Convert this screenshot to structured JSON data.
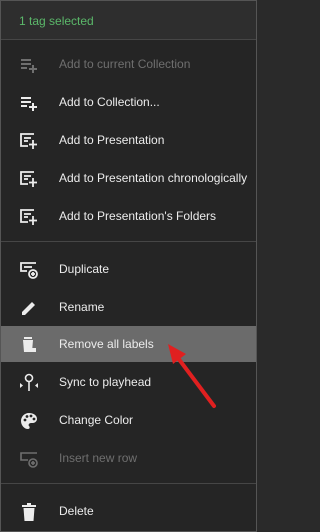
{
  "header": {
    "title": "1 tag selected"
  },
  "items": [
    {
      "label": "Add to current Collection",
      "icon": "playlist-add-icon",
      "disabled": true
    },
    {
      "label": "Add to Collection...",
      "icon": "playlist-add-icon"
    },
    {
      "label": "Add to Presentation",
      "icon": "presentation-add-icon"
    },
    {
      "label": "Add to Presentation chronologically",
      "icon": "presentation-add-icon"
    },
    {
      "label": "Add to Presentation's Folders",
      "icon": "presentation-add-icon"
    },
    {
      "label": "Duplicate",
      "icon": "duplicate-icon"
    },
    {
      "label": "Rename",
      "icon": "pencil-icon"
    },
    {
      "label": "Remove all labels",
      "icon": "remove-labels-icon",
      "highlighted": true
    },
    {
      "label": "Sync to playhead",
      "icon": "sync-playhead-icon"
    },
    {
      "label": "Change Color",
      "icon": "palette-icon"
    },
    {
      "label": "Insert new row",
      "icon": "insert-row-icon",
      "disabled": true
    },
    {
      "label": "Delete",
      "icon": "trash-icon"
    }
  ],
  "colors": {
    "header_text": "#5bb86a",
    "highlight": "#6b6b6b",
    "annotation_arrow": "#e02020"
  }
}
